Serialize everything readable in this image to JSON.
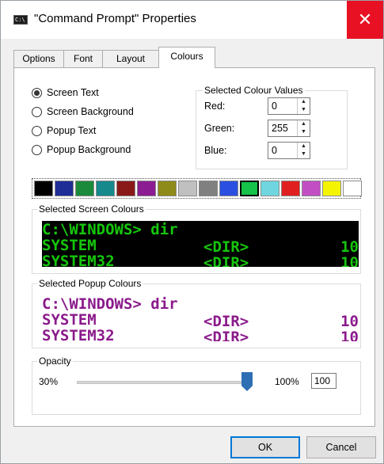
{
  "window": {
    "title": "\"Command Prompt\" Properties",
    "icon": "cmd-window-icon",
    "close_glyph": "✕"
  },
  "tabs": [
    {
      "label": "Options",
      "active": false
    },
    {
      "label": "Font",
      "active": false
    },
    {
      "label": "Layout",
      "active": false
    },
    {
      "label": "Colours",
      "active": true
    }
  ],
  "targets": [
    {
      "label": "Screen Text",
      "checked": true
    },
    {
      "label": "Screen Background",
      "checked": false
    },
    {
      "label": "Popup Text",
      "checked": false
    },
    {
      "label": "Popup Background",
      "checked": false
    }
  ],
  "selected_values": {
    "legend": "Selected Colour Values",
    "rows": [
      {
        "label": "Red:",
        "value": "0"
      },
      {
        "label": "Green:",
        "value": "255"
      },
      {
        "label": "Blue:",
        "value": "0"
      }
    ],
    "up_glyph": "▲",
    "down_glyph": "▼"
  },
  "palette": {
    "colors": [
      "#000000",
      "#1f2d96",
      "#1c8a3b",
      "#15898c",
      "#8a1919",
      "#8c1c91",
      "#8f8b1a",
      "#c0c0c0",
      "#808080",
      "#2b4fe0",
      "#15c24a",
      "#6fd6df",
      "#e02020",
      "#c24ec4",
      "#f4f400",
      "#ffffff"
    ],
    "selected_index": 10
  },
  "screen_preview": {
    "legend": "Selected Screen Colours",
    "background": "#000000",
    "text_color": "#16c60c",
    "line1": "C:\\WINDOWS> dir",
    "line2_name": "SYSTEM",
    "line2_dir": "<DIR>",
    "line2_num": "10",
    "line3_name": "SYSTEM32",
    "line3_dir": "<DIR>",
    "line3_num": "10"
  },
  "popup_preview": {
    "legend": "Selected Popup Colours",
    "background": "#ffffff",
    "text_color": "#8b1a8b",
    "line1": "C:\\WINDOWS> dir",
    "line2_name": "SYSTEM",
    "line2_dir": "<DIR>",
    "line2_num": "10",
    "line3_name": "SYSTEM32",
    "line3_dir": "<DIR>",
    "line3_num": "10"
  },
  "opacity": {
    "legend": "Opacity",
    "min_label": "30%",
    "max_label": "100%",
    "value": "100",
    "level": 1.0
  },
  "buttons": {
    "ok": "OK",
    "cancel": "Cancel"
  }
}
